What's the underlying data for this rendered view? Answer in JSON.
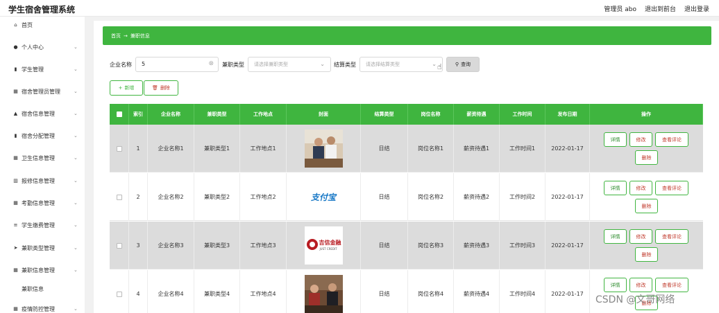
{
  "header": {
    "app_title": "学生宿舍管理系统",
    "admin_label": "管理员 abo",
    "back_link": "退出到前台",
    "logout_link": "退出登录"
  },
  "sidebar": {
    "items": [
      {
        "label": "首页",
        "icon": "home-icon",
        "glyph": "⌂",
        "has_chevron": false
      },
      {
        "label": "个人中心",
        "icon": "user-icon",
        "glyph": "●",
        "has_chevron": true
      },
      {
        "label": "学生管理",
        "icon": "book-icon",
        "glyph": "▮",
        "has_chevron": true
      },
      {
        "label": "宿舍管理员管理",
        "icon": "grid-icon",
        "glyph": "▦",
        "has_chevron": true
      },
      {
        "label": "宿舍信息管理",
        "icon": "bank-icon",
        "glyph": "▲",
        "has_chevron": true
      },
      {
        "label": "宿舍分配管理",
        "icon": "book-icon",
        "glyph": "▮",
        "has_chevron": true
      },
      {
        "label": "卫生信息管理",
        "icon": "grid-icon",
        "glyph": "▦",
        "has_chevron": true
      },
      {
        "label": "报修信息管理",
        "icon": "bar-chart-icon",
        "glyph": "▥",
        "has_chevron": true
      },
      {
        "label": "考勤信息管理",
        "icon": "grid-icon",
        "glyph": "▦",
        "has_chevron": true
      },
      {
        "label": "学生缴费管理",
        "icon": "list-icon",
        "glyph": "≡",
        "has_chevron": true
      },
      {
        "label": "兼职类型管理",
        "icon": "send-icon",
        "glyph": "➤",
        "has_chevron": true
      },
      {
        "label": "兼职信息管理",
        "icon": "grid-icon",
        "glyph": "▦",
        "has_chevron": true
      },
      {
        "label": "疫情防控管理",
        "icon": "grid-icon",
        "glyph": "▦",
        "has_chevron": true
      }
    ],
    "sub_item": "兼职信息"
  },
  "breadcrumb": {
    "home": "首页",
    "separator": "→",
    "current": "兼职信息"
  },
  "filters": {
    "company_label": "企业名称",
    "company_value": "5",
    "type_label": "兼职类型",
    "type_placeholder": "请选择兼职类型",
    "settle_label": "结算类型",
    "settle_placeholder": "请选择结算类型",
    "search_button": "查询"
  },
  "actions": {
    "add": "新增",
    "delete": "删除"
  },
  "table": {
    "headers": [
      "索引",
      "企业名称",
      "兼职类型",
      "工作地点",
      "封面",
      "结算类型",
      "岗位名称",
      "薪资待遇",
      "工作时间",
      "发布日期",
      "操作"
    ],
    "rows": [
      {
        "index": "1",
        "company": "企业名称1",
        "type": "兼职类型1",
        "place": "工作地点1",
        "cover": "office-photo",
        "settle": "日结",
        "post": "岗位名称1",
        "salary": "薪资待遇1",
        "time": "工作时间1",
        "date": "2022-01-17"
      },
      {
        "index": "2",
        "company": "企业名称2",
        "type": "兼职类型2",
        "place": "工作地点2",
        "cover": "alipay-logo",
        "settle": "日结",
        "post": "岗位名称2",
        "salary": "薪资待遇2",
        "time": "工作时间2",
        "date": "2022-01-17"
      },
      {
        "index": "3",
        "company": "企业名称3",
        "type": "兼职类型3",
        "place": "工作地点3",
        "cover": "jixin-logo",
        "settle": "日结",
        "post": "岗位名称3",
        "salary": "薪资待遇3",
        "time": "工作时间3",
        "date": "2022-01-17"
      },
      {
        "index": "4",
        "company": "企业名称4",
        "type": "兼职类型4",
        "place": "工作地点4",
        "cover": "meeting-photo",
        "settle": "日结",
        "post": "岗位名称4",
        "salary": "薪资待遇4",
        "time": "工作时间4",
        "date": "2022-01-17"
      }
    ],
    "ops": {
      "detail": "详情",
      "edit": "修改",
      "comments": "查看评论",
      "delete": "删除"
    }
  },
  "logos": {
    "alipay": "支付宝",
    "jixin": "吉信金融",
    "jixin_en": "JUST CREDIT"
  },
  "watermark": "CSDN @文哥网络"
}
